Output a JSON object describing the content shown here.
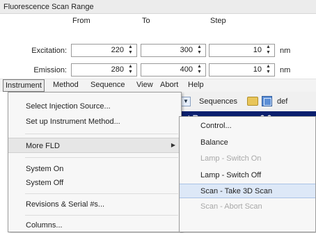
{
  "fluorescence": {
    "title": "Fluorescence Scan Range",
    "headers": {
      "from": "From",
      "to": "To",
      "step": "Step"
    },
    "rows": [
      {
        "label": "Excitation:",
        "from": "220",
        "to": "300",
        "step": "10",
        "unit": "nm"
      },
      {
        "label": "Emission:",
        "from": "280",
        "to": "400",
        "step": "10",
        "unit": "nm"
      }
    ]
  },
  "menubar": {
    "items": [
      "Instrument",
      "Method",
      "Sequence",
      "View",
      "Abort",
      "Help"
    ]
  },
  "toolbar": {
    "sequences_label": "Sequences",
    "def_label": "def",
    "status_text": "ast Run",
    "status_value": "0.0",
    "colors": {
      "status_bg": "#0a1f6e"
    }
  },
  "instrument_menu": {
    "items": [
      "Select Injection Source...",
      "Set up Instrument Method...",
      "More FLD",
      "System On",
      "System Off",
      "Revisions & Serial #s...",
      "Columns..."
    ]
  },
  "more_fld_submenu": {
    "items": [
      {
        "label": "Control...",
        "enabled": true
      },
      {
        "label": "Balance",
        "enabled": true
      },
      {
        "label": "Lamp - Switch On",
        "enabled": false
      },
      {
        "label": "Lamp - Switch Off",
        "enabled": true
      },
      {
        "label": "Scan - Take 3D Scan",
        "enabled": true,
        "highlighted": true
      },
      {
        "label": "Scan - Abort Scan",
        "enabled": false
      }
    ]
  }
}
